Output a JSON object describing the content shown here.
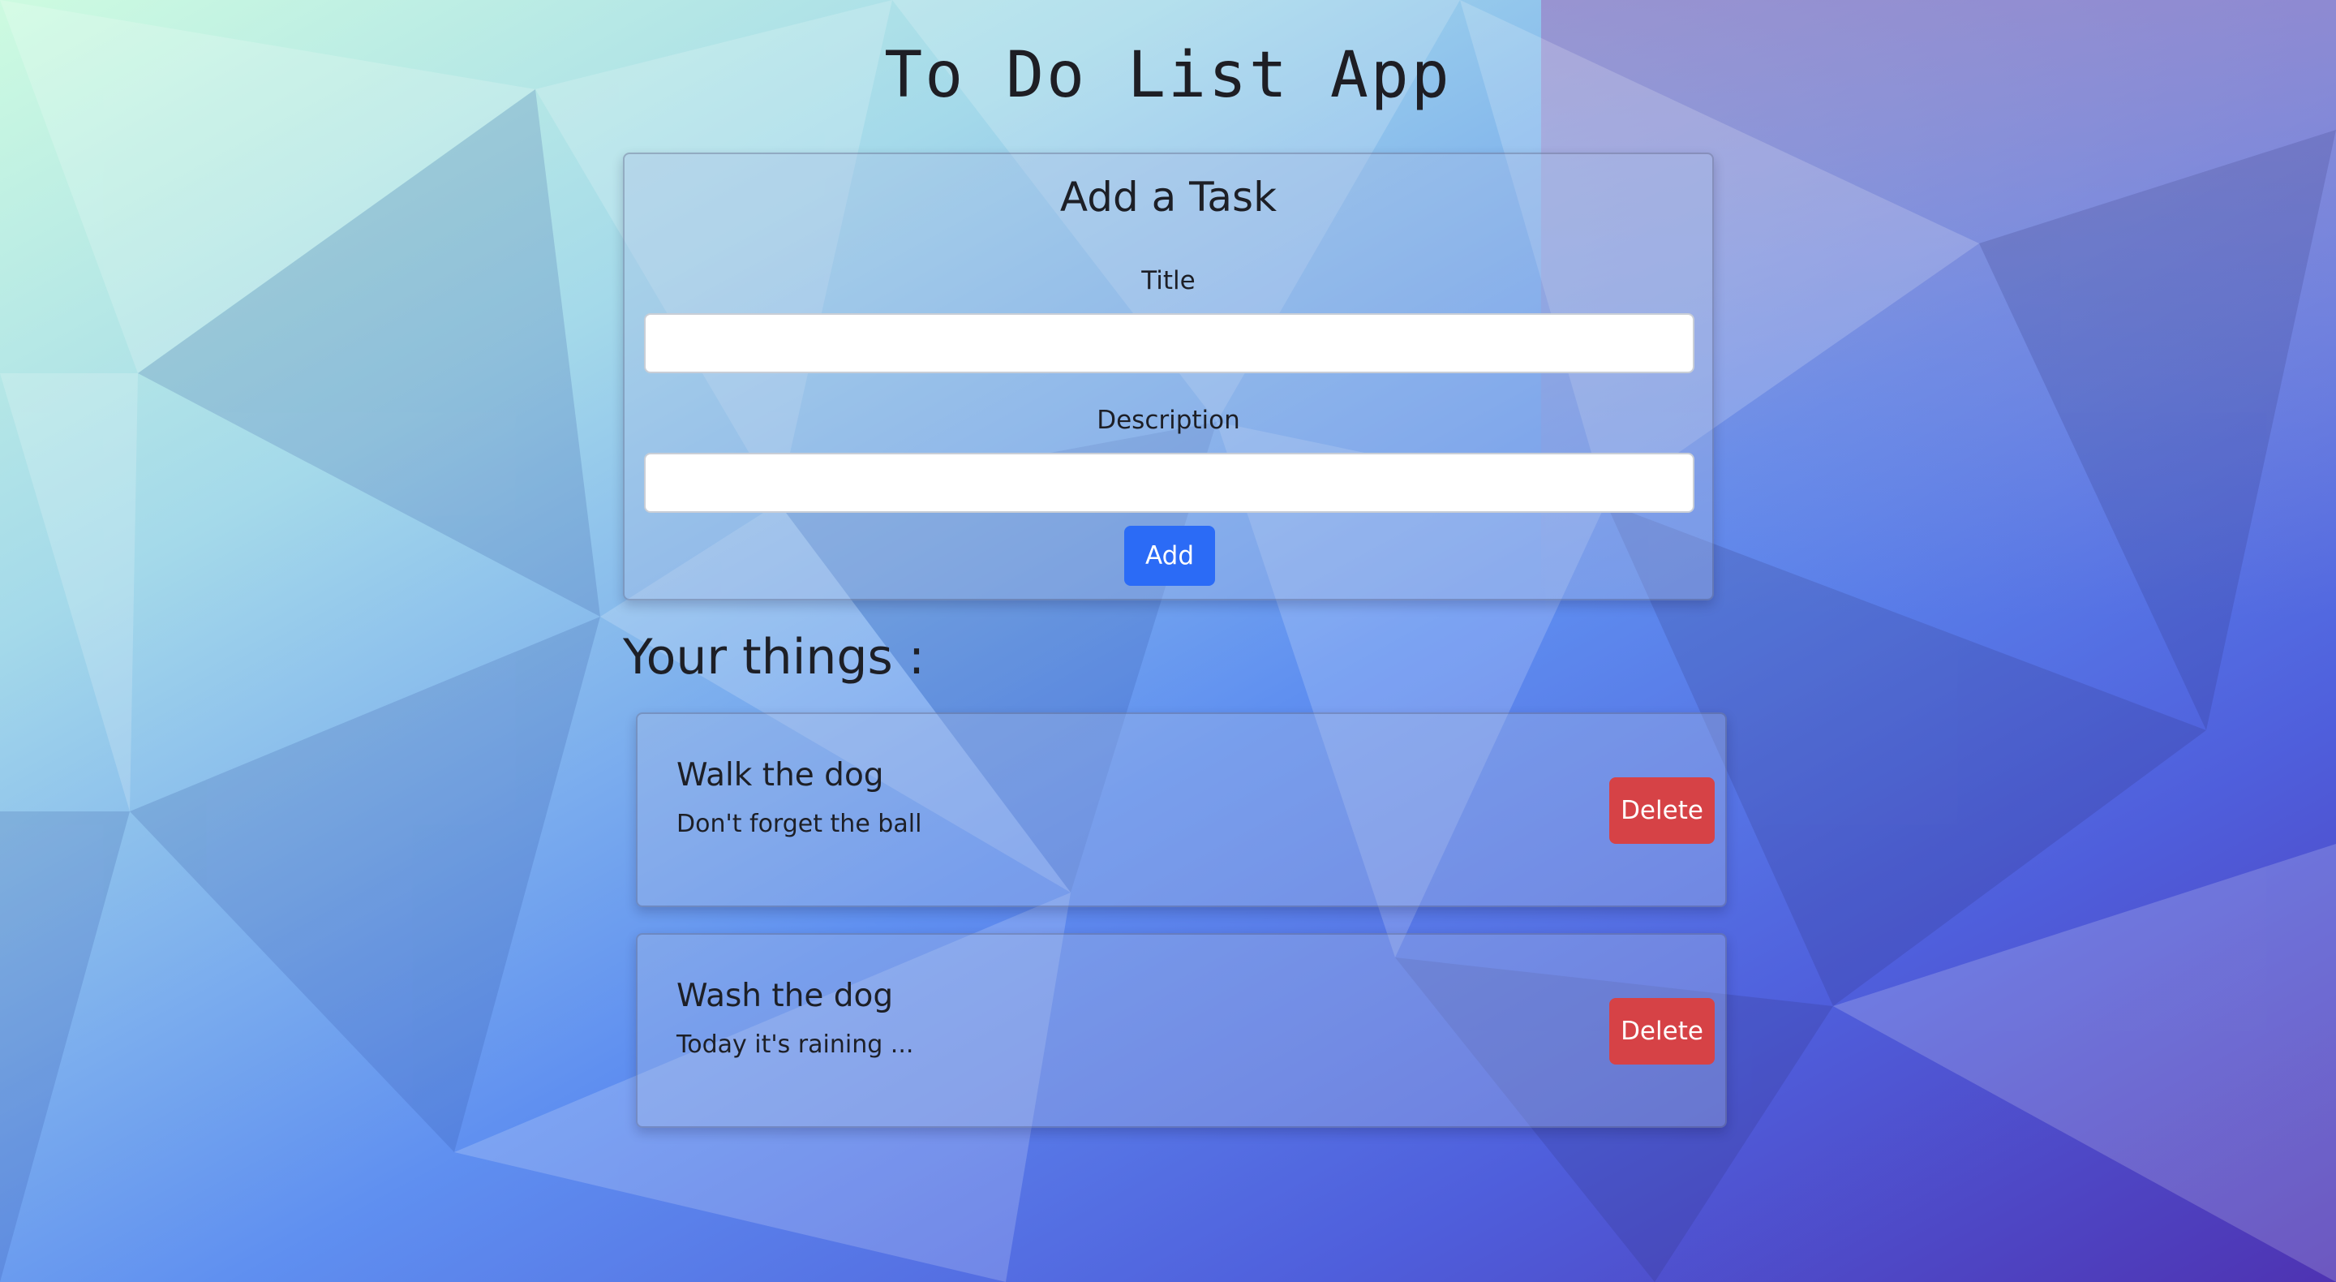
{
  "app": {
    "title": "To Do List App"
  },
  "add_task": {
    "heading": "Add a Task",
    "title_label": "Title",
    "title_value": "",
    "description_label": "Description",
    "description_value": "",
    "add_label": "Add"
  },
  "tasks_section": {
    "heading": "Your things :"
  },
  "tasks": [
    {
      "title": "Walk the dog",
      "description": "Don't forget the ball",
      "delete_label": "Delete"
    },
    {
      "title": "Wash the dog",
      "description": "Today it's raining ...",
      "delete_label": "Delete"
    }
  ],
  "colors": {
    "primary_button": "#2b6bf6",
    "danger_button": "#d64246",
    "background_top_left": "#c9f7e0",
    "background_bottom_right": "#4f37b6"
  }
}
